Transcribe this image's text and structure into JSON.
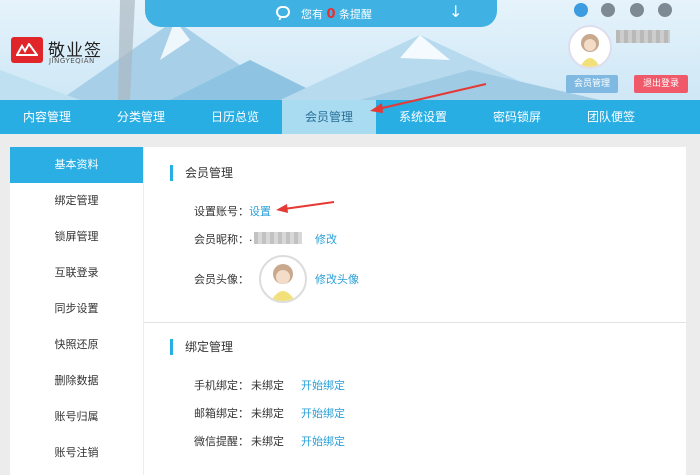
{
  "notice": {
    "prefix": "您有",
    "count": "0",
    "suffix": "条提醒",
    "icon": "message-icon",
    "collapse_icon": "arrow-down-icon"
  },
  "brand": {
    "name": "敬业签",
    "sub": "JINGYEQIAN"
  },
  "platforms": [
    "ie-icon",
    "windows-icon",
    "apple-icon",
    "android-icon"
  ],
  "user": {
    "member_btn": "会员管理",
    "logout_btn": "退出登录"
  },
  "nav": [
    "内容管理",
    "分类管理",
    "日历总览",
    "会员管理",
    "系统设置",
    "密码锁屏",
    "团队便签"
  ],
  "nav_active": 3,
  "sidebar": [
    "基本资料",
    "绑定管理",
    "锁屏管理",
    "互联登录",
    "同步设置",
    "快照还原",
    "删除数据",
    "账号归属",
    "账号注销"
  ],
  "member": {
    "title": "会员管理",
    "account_label": "设置账号：",
    "account_link": "设置",
    "nick_label": "会员昵称：",
    "nick_value": ".",
    "nick_edit": "修改",
    "avatar_label": "会员头像：",
    "avatar_edit": "修改头像"
  },
  "bind": {
    "title": "绑定管理",
    "rows": [
      {
        "label": "手机绑定：",
        "status": "未绑定",
        "action": "开始绑定"
      },
      {
        "label": "邮箱绑定：",
        "status": "未绑定",
        "action": "开始绑定"
      },
      {
        "label": "微信提醒：",
        "status": "未绑定",
        "action": "开始绑定"
      }
    ]
  },
  "colors": {
    "accent": "#29aee3",
    "logout": "#f0596a",
    "logo": "#e0252b"
  }
}
